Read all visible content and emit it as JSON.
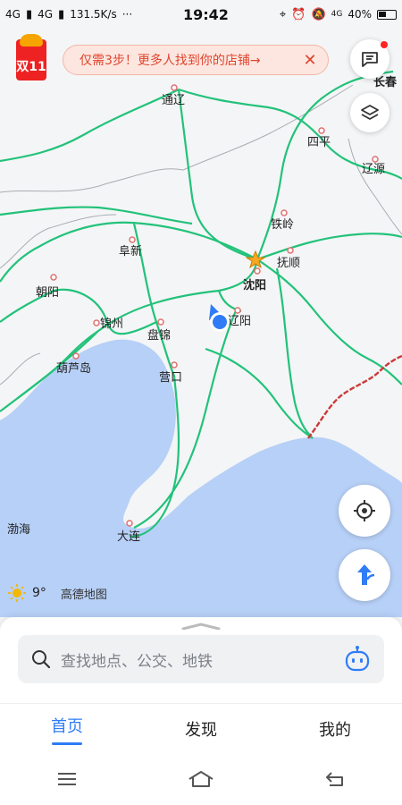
{
  "status_bar": {
    "signal_1": "4G",
    "signal_2": "4G",
    "speed": "131.5K/s",
    "more": "···",
    "time": "19:42",
    "network_small": "4G",
    "battery_percent": "40%"
  },
  "promo_badge": {
    "text": "双11",
    "color": "#e22222"
  },
  "notice": {
    "text": "仅需3步！更多人找到你的店铺→",
    "close": "✕"
  },
  "map": {
    "cities": [
      {
        "name": "长春"
      },
      {
        "name": "通辽"
      },
      {
        "name": "四平"
      },
      {
        "name": "辽源"
      },
      {
        "name": "铁岭"
      },
      {
        "name": "阜新"
      },
      {
        "name": "抚顺"
      },
      {
        "name": "沈阳"
      },
      {
        "name": "朝阳"
      },
      {
        "name": "辽阳"
      },
      {
        "name": "锦州"
      },
      {
        "name": "盘锦"
      },
      {
        "name": "葫芦岛"
      },
      {
        "name": "营口"
      },
      {
        "name": "渤海"
      },
      {
        "name": "大连"
      }
    ],
    "colors": {
      "land": "#f4f5f6",
      "sea": "#b7d0f7",
      "road": "#22c27a",
      "border": "#cc3a3a",
      "location": "#2f7cf6"
    }
  },
  "weather": {
    "temperature": "9°",
    "map_brand": "高德地图"
  },
  "search": {
    "placeholder": "查找地点、公交、地铁"
  },
  "tabs": [
    {
      "label": "首页",
      "active": true
    },
    {
      "label": "发现",
      "active": false
    },
    {
      "label": "我的",
      "active": false
    }
  ]
}
